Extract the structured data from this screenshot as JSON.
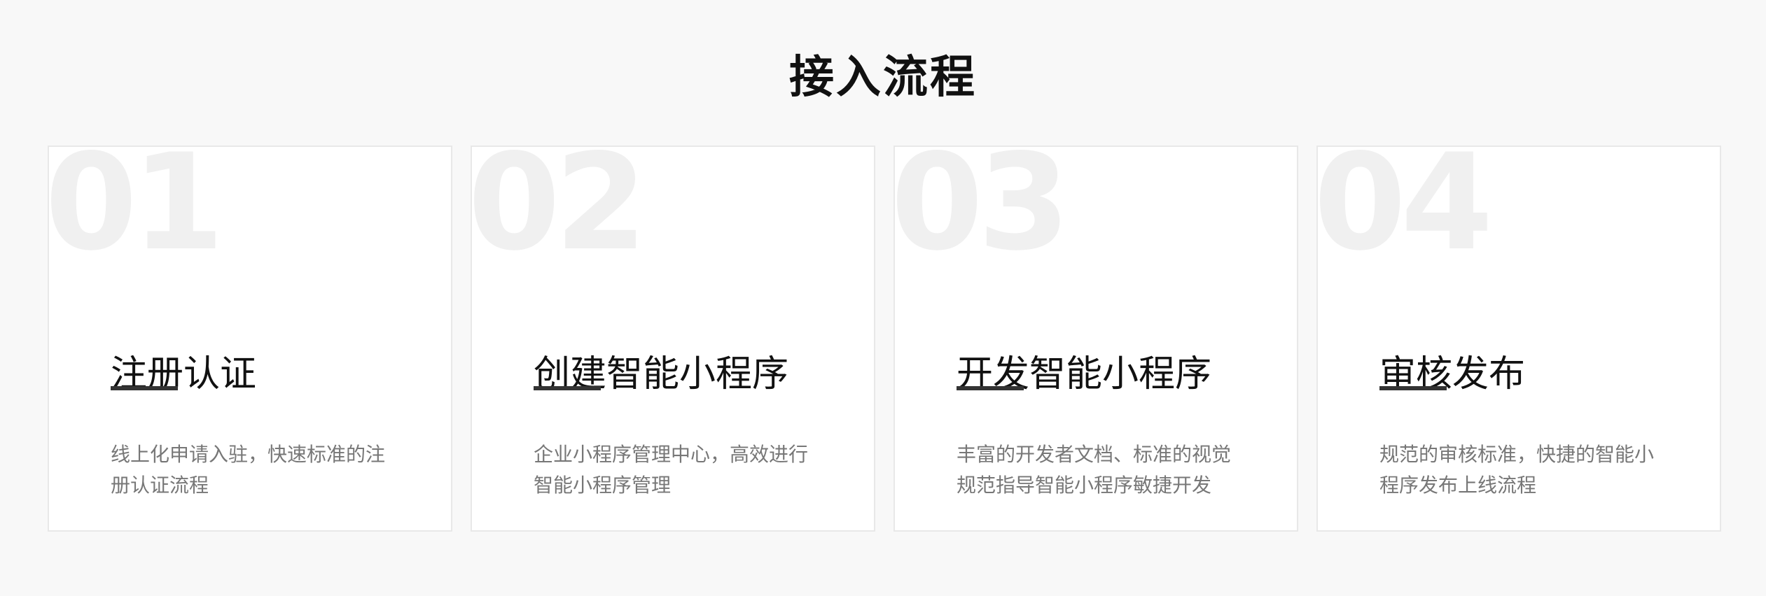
{
  "section": {
    "title": "接入流程"
  },
  "steps": [
    {
      "number": "01",
      "title": "注册认证",
      "description": "线上化申请入驻，快速标准的注册认证流程"
    },
    {
      "number": "02",
      "title": "创建智能小程序",
      "description": "企业小程序管理中心，高效进行智能小程序管理"
    },
    {
      "number": "03",
      "title": "开发智能小程序",
      "description": "丰富的开发者文档、标准的视觉规范指导智能小程序敏捷开发"
    },
    {
      "number": "04",
      "title": "审核发布",
      "description": "规范的审核标准，快捷的智能小程序发布上线流程"
    }
  ],
  "colors": {
    "background": "#f8f8f8",
    "card": "#ffffff",
    "number_watermark": "#f0f0f0",
    "title": "#111111",
    "rule": "#333333",
    "description": "#777777"
  }
}
